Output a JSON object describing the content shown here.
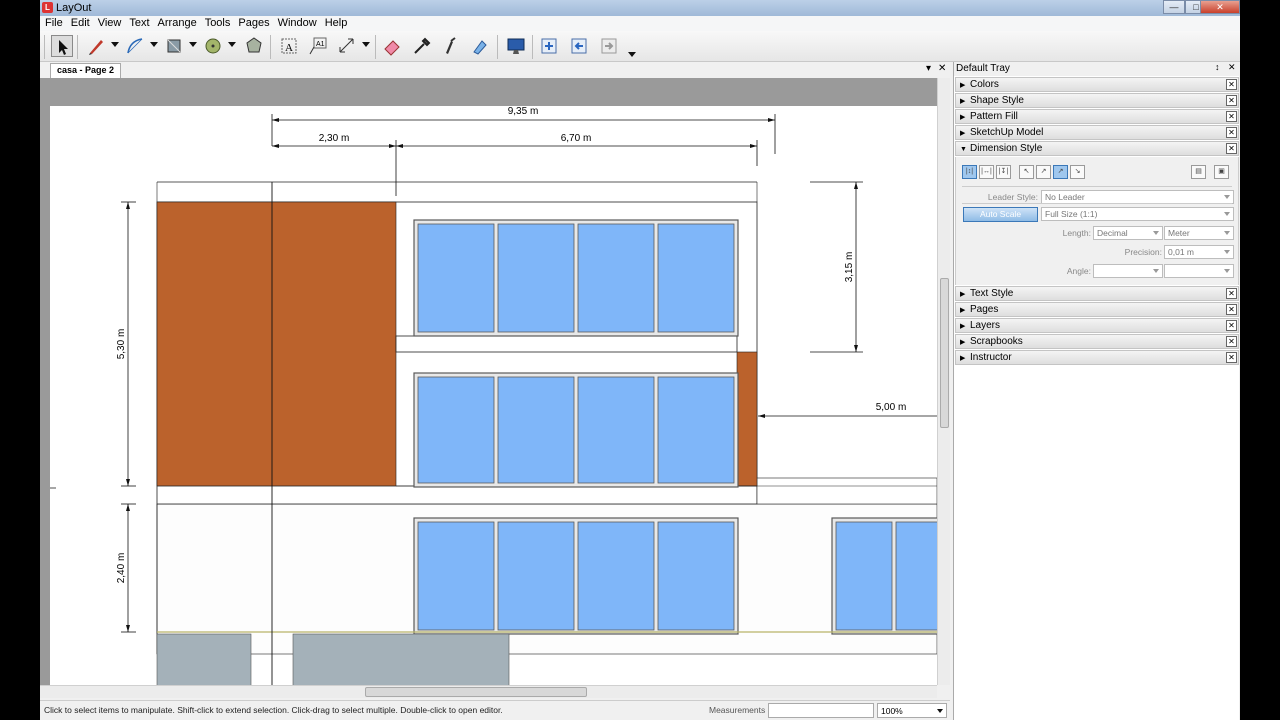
{
  "window": {
    "title": "LayOut",
    "minimize": "0",
    "maximize": "1",
    "close": "r"
  },
  "menu": {
    "items": [
      "File",
      "Edit",
      "View",
      "Text",
      "Arrange",
      "Tools",
      "Pages",
      "Window",
      "Help"
    ]
  },
  "toolbar": {
    "tools": [
      "select-tool",
      "line-tool",
      "arc-tool",
      "rectangle-tool",
      "circle-tool",
      "polygon-tool",
      "text-tool",
      "label-tool",
      "dimension-tool",
      "eraser-tool",
      "style-tool",
      "split-tool",
      "join-tool",
      "presentation-tool",
      "add-page-tool",
      "previous-page-tool",
      "next-page-tool"
    ]
  },
  "document": {
    "tab_label": "casa - Page 2",
    "tab_nav": "▾",
    "tab_close": "✕"
  },
  "drawing": {
    "dimensions": {
      "total_width": "9,35 m",
      "left_width": "2,30 m",
      "right_width": "6,70 m",
      "upper_height": "5,30 m",
      "lower_height": "2,40 m",
      "window_height": "3,15 m",
      "side_width": "5,00 m"
    },
    "colors": {
      "wall": "#bb622c",
      "glass": "#7fb6f9",
      "frame": "#5a5a5a",
      "base": "#a4b1b9"
    }
  },
  "tray": {
    "title": "Default Tray",
    "pin": "↕",
    "close": "✕",
    "panels": [
      {
        "label": "Colors",
        "state": "collapsed"
      },
      {
        "label": "Shape Style",
        "state": "collapsed"
      },
      {
        "label": "Pattern Fill",
        "state": "collapsed"
      },
      {
        "label": "SketchUp Model",
        "state": "collapsed"
      },
      {
        "label": "Dimension Style",
        "state": "expanded"
      },
      {
        "label": "Text Style",
        "state": "collapsed"
      },
      {
        "label": "Pages",
        "state": "collapsed"
      },
      {
        "label": "Layers",
        "state": "collapsed"
      },
      {
        "label": "Scrapbooks",
        "state": "collapsed"
      },
      {
        "label": "Instructor",
        "state": "collapsed"
      }
    ],
    "dimension_style": {
      "leader_style_label": "Leader Style:",
      "leader_style_value": "No Leader",
      "auto_scale_label": "Auto Scale",
      "scale_value": "Full Size (1:1)",
      "length_label": "Length:",
      "length_format": "Decimal",
      "length_unit": "Meter",
      "precision_label": "Precision:",
      "precision_value": "0,01 m",
      "angle_label": "Angle:",
      "angle_format": "",
      "angle_precision": ""
    }
  },
  "status": {
    "message": "Click to select items to manipulate. Shift-click to extend selection. Click-drag to select multiple. Double-click to open editor.",
    "measurements_label": "Measurements",
    "measurements_value": "",
    "zoom": "100%"
  }
}
